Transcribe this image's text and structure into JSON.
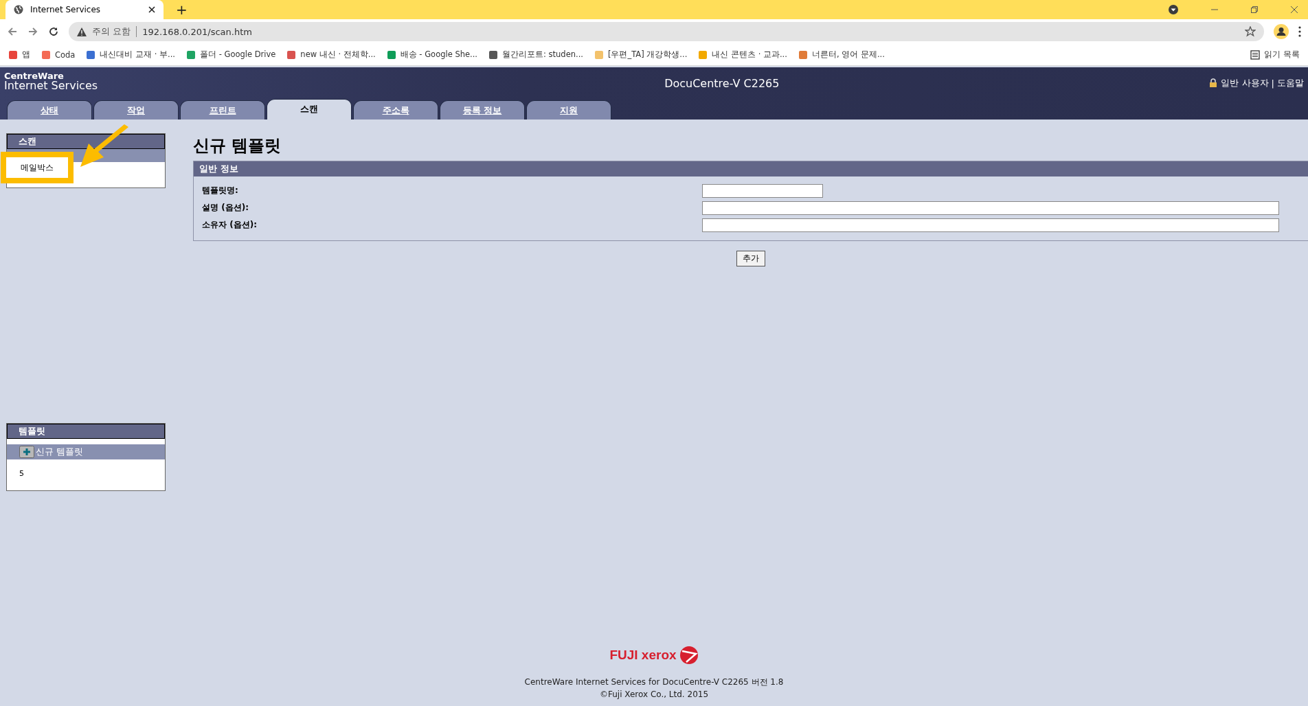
{
  "browser": {
    "tab_title": "Internet Services",
    "new_tab": "+",
    "security": "주의 요함",
    "url": "192.168.0.201/scan.htm",
    "bookmarks": [
      {
        "label": "앱",
        "color": "#e8453c"
      },
      {
        "label": "Coda",
        "color": "#f46a54"
      },
      {
        "label": "내신대비 교재 · 부...",
        "color": "#3b6fd1"
      },
      {
        "label": "폴더 - Google Drive",
        "color": "#1fa463"
      },
      {
        "label": "new 내신 · 전체학...",
        "color": "#d9534f"
      },
      {
        "label": "배송 - Google She...",
        "color": "#0f9d58"
      },
      {
        "label": "월간리포트: studen...",
        "color": "#555555"
      },
      {
        "label": "[우편_TA] 개강학생...",
        "color": "#f3c26b"
      },
      {
        "label": "내신 콘텐츠 · 교과...",
        "color": "#f2a900"
      },
      {
        "label": "너른터, 영어 문제...",
        "color": "#e07b39"
      }
    ],
    "reading_list": "읽기 목록"
  },
  "header": {
    "brand_line1": "CentreWare",
    "brand_line2": "Internet Services",
    "device": "DocuCentre-V C2265",
    "user": "일반 사용자",
    "separator": "|",
    "help": "도움말"
  },
  "tabs": [
    {
      "label": "상태",
      "selected": false
    },
    {
      "label": "작업",
      "selected": false
    },
    {
      "label": "프린트",
      "selected": false
    },
    {
      "label": "스캔",
      "selected": true
    },
    {
      "label": "주소록",
      "selected": false
    },
    {
      "label": "등록 정보",
      "selected": false
    },
    {
      "label": "지원",
      "selected": false
    }
  ],
  "sidebar": {
    "title": "스캔",
    "highlight": "메일박스"
  },
  "page_title": "신규 템플릿",
  "form": {
    "section": "일반 정보",
    "fields": [
      {
        "label": "템플릿명:",
        "wide": false
      },
      {
        "label": "설명 (옵션):",
        "wide": true
      },
      {
        "label": "소유자 (옵션):",
        "wide": true
      }
    ],
    "button": "추가"
  },
  "templates": {
    "title": "템플릿",
    "new_item": "신규 템플릿",
    "count": "5"
  },
  "footer": {
    "logo": "FUJI xerox",
    "line1": "CentreWare Internet Services for DocuCentre-V C2265 버전 1.8",
    "line2": "©Fuji Xerox Co., Ltd. 2015"
  }
}
